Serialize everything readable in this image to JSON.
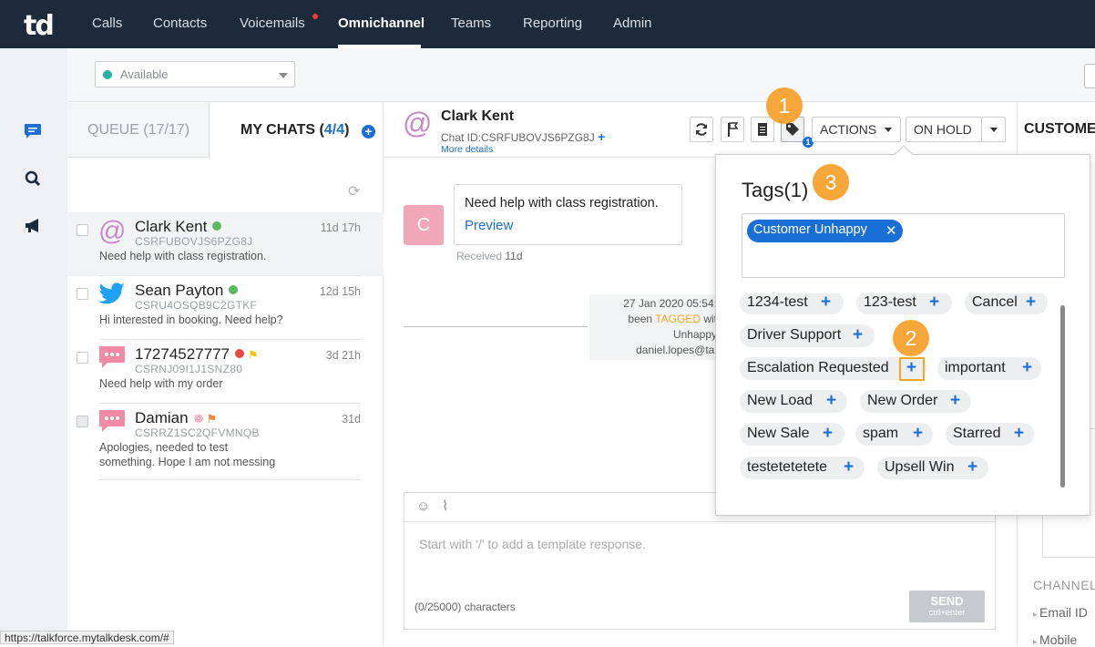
{
  "nav": {
    "logo": "td",
    "items": [
      "Calls",
      "Contacts",
      "Voicemails",
      "Omnichannel",
      "Teams",
      "Reporting",
      "Admin"
    ],
    "active": "Omnichannel"
  },
  "status": {
    "value": "Available"
  },
  "chatlist": {
    "tab_queue": "QUEUE (17/17)",
    "tab_mine_prefix": "MY CHATS (",
    "tab_mine_count": "4/4",
    "tab_mine_suffix": ")",
    "chats": [
      {
        "name": "Clark Kent",
        "id": "CSRFUBOVJS6PZG8J",
        "msg": "Need help with class registration.",
        "time": "11d 17h"
      },
      {
        "name": "Sean Payton",
        "id": "CSRU4OSQB9C2GTKF",
        "msg": "Hi interested in booking. Need help?",
        "time": "12d 15h"
      },
      {
        "name": "17274527777",
        "id": "CSRNJ09I1J1SNZ80",
        "msg": "Need help with my order",
        "time": "3d 21h"
      },
      {
        "name": "Damian",
        "id": "CSRRZ1SC2QFVMNQB",
        "msg_line1": "Apologies, needed to test",
        "msg_line2": "something. Hope I am not messing",
        "time": "31d"
      }
    ]
  },
  "conversation": {
    "name": "Clark Kent",
    "chat_id": "Chat ID:CSRFUBOVJS6PZG8J",
    "more_details": "More details",
    "actions_label": "ACTIONS",
    "onhold_label": "ON HOLD",
    "tag_badge": "1",
    "message": {
      "avatar": "C",
      "text": "Need help with class registration.",
      "preview": "Preview",
      "received_label": "Received",
      "received_value": "11d"
    },
    "system": {
      "line1": "27 Jan 2020 05:54:",
      "line2a": "been ",
      "line2b": "TAGGED",
      "line2c": " wit",
      "line3": "Unhappy",
      "line4": "daniel.lopes@tal"
    },
    "composer": {
      "placeholder": "Start with '/' to add a template response.",
      "counter": "(0/25000) characters",
      "send": "SEND",
      "send_hint": "ctrl+enter"
    }
  },
  "customer_panel": {
    "title": "CUSTOME",
    "channel": "CHANNEL",
    "email": "Email ID",
    "mobile": "Mobile"
  },
  "tags_popup": {
    "title": "Tags(1)",
    "selected": [
      "Customer Unhappy"
    ],
    "available": [
      "1234-test",
      "123-test",
      "Cancel",
      "Driver Support",
      "Escalation Requested",
      "important",
      "New Load",
      "New Order",
      "New Sale",
      "spam",
      "Starred",
      "testetetetete",
      "Upsell Win"
    ]
  },
  "callouts": [
    "1",
    "2",
    "3"
  ],
  "status_url": "https://talkforce.mytalkdesk.com/#",
  "colors": {
    "nav_bg": "#1d2a3c",
    "accent": "#1a6fd6",
    "callout": "#f7a73a",
    "available": "#23b39e"
  }
}
